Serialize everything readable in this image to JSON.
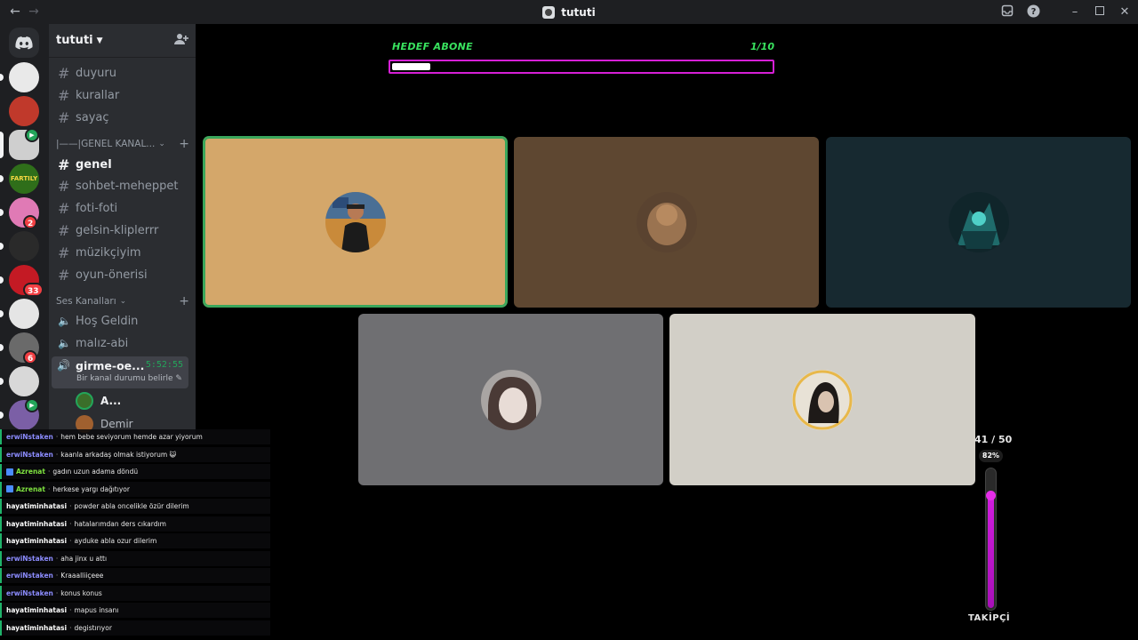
{
  "window": {
    "title": "tututi",
    "back_icon": "arrow-left-icon",
    "forward_icon": "arrow-right-icon",
    "inbox_icon": "inbox-icon",
    "help_icon": "help-icon",
    "minimize_icon": "minimize-icon",
    "maximize_icon": "maximize-icon",
    "close_icon": "close-icon"
  },
  "server_rail": {
    "servers": [
      {
        "name": "server-1",
        "color": "#e9e9e9",
        "badge": "",
        "selected": false,
        "unread": true
      },
      {
        "name": "server-2",
        "color": "#c0392b",
        "badge": "",
        "selected": false,
        "unread": false
      },
      {
        "name": "server-3",
        "color": "#cfcfcf",
        "badge": "",
        "selected": true,
        "unread": false,
        "voice": true
      },
      {
        "name": "server-4",
        "color": "#2f6e1a",
        "badge": "",
        "selected": false,
        "unread": true,
        "text": "FARTILY"
      },
      {
        "name": "server-5",
        "color": "#e07ab5",
        "badge": "2",
        "selected": false,
        "unread": true
      },
      {
        "name": "server-6",
        "color": "#2a2a2a",
        "badge": "",
        "selected": false,
        "unread": true
      },
      {
        "name": "server-7",
        "color": "#c41a24",
        "badge": "33",
        "selected": false,
        "unread": true
      },
      {
        "name": "server-8",
        "color": "#e5e5e5",
        "badge": "",
        "selected": false,
        "unread": true
      },
      {
        "name": "server-9",
        "color": "#6a6a6a",
        "badge": "6",
        "selected": false,
        "unread": true
      },
      {
        "name": "server-10",
        "color": "#d8d8d8",
        "badge": "",
        "selected": false,
        "unread": true
      },
      {
        "name": "server-11",
        "color": "#7b5fa6",
        "badge": "",
        "selected": false,
        "unread": true,
        "voice": true
      }
    ]
  },
  "sidebar": {
    "guild_name": "tututi",
    "add_member_icon": "add-member-icon",
    "text_channels_top": [
      "duyuru",
      "kurallar",
      "sayaç"
    ],
    "category_general": "|——|GENEL KANAL...",
    "text_channels": [
      "genel",
      "sohbet-meheppet",
      "foti-foti",
      "gelsin-kliplerrr",
      "müzikçiyim",
      "oyun-önerisi"
    ],
    "active_channel": "genel",
    "category_voice": "Ses Kanalları",
    "voice_channels": [
      "Hoş Geldin",
      "malız-abi"
    ],
    "active_voice": {
      "name": "girme-oe...",
      "timer": "5:52:55",
      "status": "Bir kanal durumu belirle"
    },
    "voice_users": [
      {
        "name": "A...",
        "color": "#3b6e2a"
      },
      {
        "name": "Demir",
        "color": "#a0602f"
      }
    ]
  },
  "chat": {
    "messages": [
      {
        "user": "erwiNstaken",
        "text": "hem bebe seviyorum hemde azar yiyorum",
        "cls": "u-erwi",
        "icon": false
      },
      {
        "user": "erwiNstaken",
        "text": "kaanla arkadaş olmak istiyorum 😺",
        "cls": "u-erwi",
        "icon": false
      },
      {
        "user": "Azrenat",
        "text": "gadın uzun adama döndü",
        "cls": "u-azr",
        "icon": true
      },
      {
        "user": "Azrenat",
        "text": "herkese yargı dağıtıyor",
        "cls": "u-azr",
        "icon": true
      },
      {
        "user": "hayatiminhatasi",
        "text": "powder abla oncelikle özür dilerim",
        "cls": "u-hay",
        "icon": false
      },
      {
        "user": "hayatiminhatasi",
        "text": "hatalarımdan ders cıkardım",
        "cls": "u-hay",
        "icon": false
      },
      {
        "user": "hayatiminhatasi",
        "text": "ayduke abla ozur dilerim",
        "cls": "u-hay",
        "icon": false
      },
      {
        "user": "erwiNstaken",
        "text": "aha jinx u attı",
        "cls": "u-erwi",
        "icon": false
      },
      {
        "user": "erwiNstaken",
        "text": "Kraaalliiçeee",
        "cls": "u-erwi",
        "icon": false
      },
      {
        "user": "erwiNstaken",
        "text": "konus konus",
        "cls": "u-erwi",
        "icon": false
      },
      {
        "user": "hayatiminhatasi",
        "text": "mapus insanı",
        "cls": "u-hay",
        "icon": false
      },
      {
        "user": "hayatiminhatasi",
        "text": "degistırıyor",
        "cls": "u-hay",
        "icon": false
      }
    ]
  },
  "goal": {
    "label": "HEDEF ABONE",
    "count": "1/10",
    "fraction": 0.1
  },
  "tiles": [
    {
      "name": "tile-1",
      "bg": "#d4a76a",
      "speaking": true,
      "avatar": "#3c5a7a"
    },
    {
      "name": "tile-2",
      "bg": "#5e4731",
      "speaking": false,
      "avatar": "#8a6a4a"
    },
    {
      "name": "tile-3",
      "bg": "#172930",
      "speaking": false,
      "avatar": "#2a5a5e"
    },
    {
      "name": "tile-4",
      "bg": "#6f6f72",
      "speaking": false,
      "avatar": "#c9c3c0"
    },
    {
      "name": "tile-5",
      "bg": "#d2cfc7",
      "speaking": false,
      "avatar": "#2a2420"
    }
  ],
  "followers": {
    "value": "41 / 50",
    "percent": "82%",
    "fraction": 0.82,
    "label": "TAKİPÇİ"
  }
}
